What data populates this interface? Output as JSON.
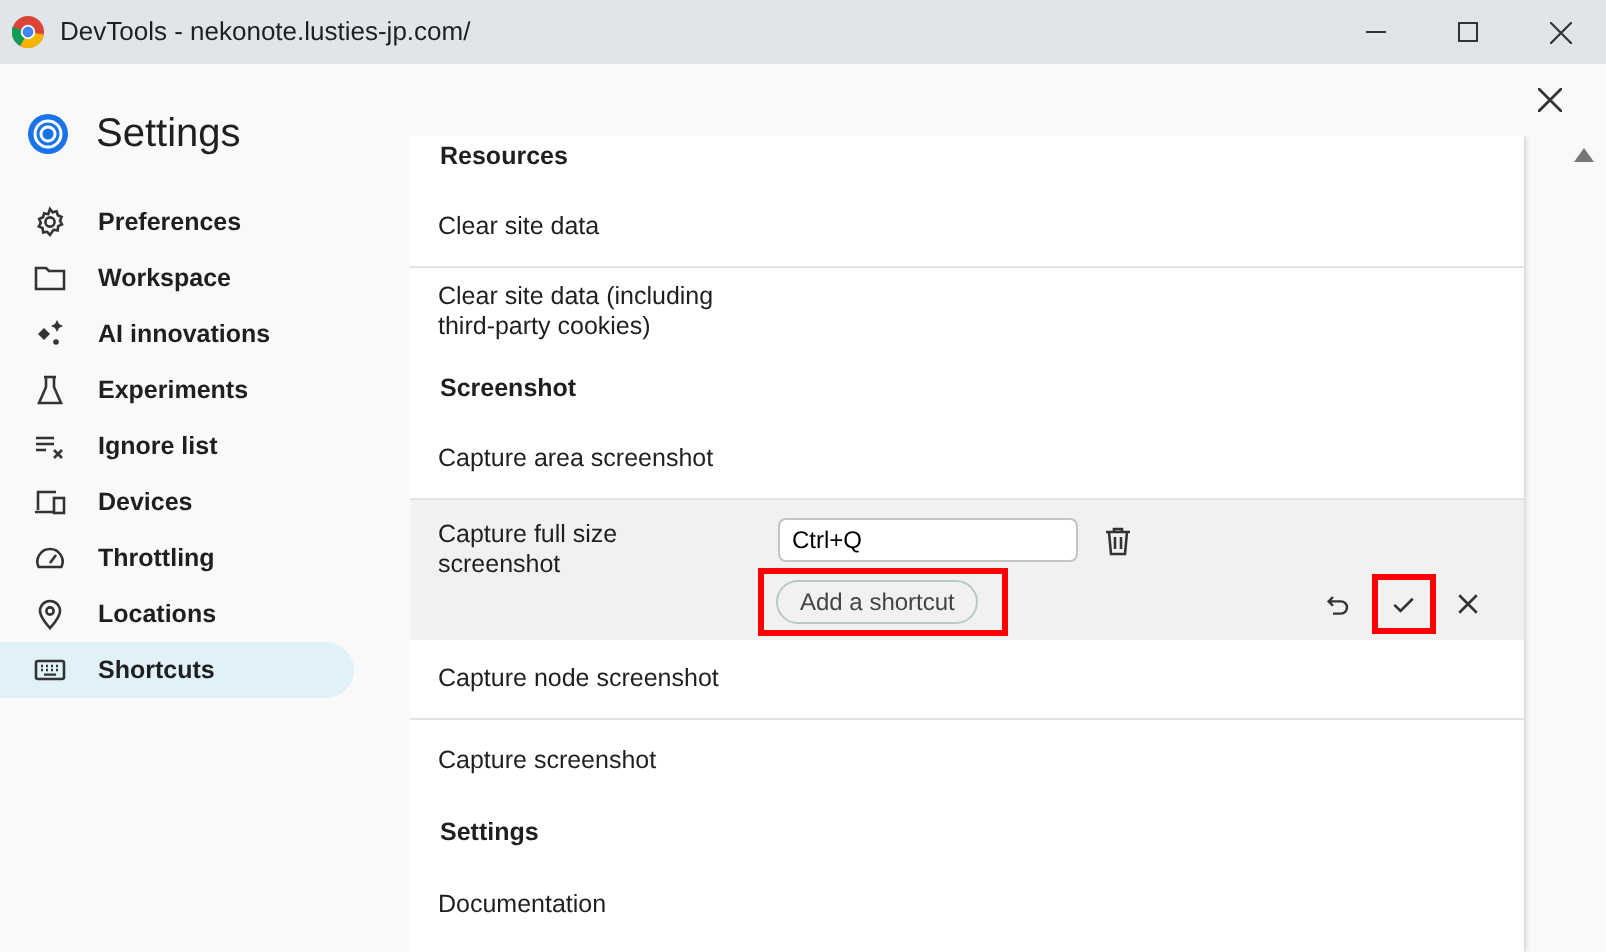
{
  "window": {
    "title": "DevTools - nekonote.lusties-jp.com/"
  },
  "settings": {
    "title": "Settings"
  },
  "sidebar": {
    "items": [
      {
        "label": "Preferences",
        "selected": false
      },
      {
        "label": "Workspace",
        "selected": false
      },
      {
        "label": "AI innovations",
        "selected": false
      },
      {
        "label": "Experiments",
        "selected": false
      },
      {
        "label": "Ignore list",
        "selected": false
      },
      {
        "label": "Devices",
        "selected": false
      },
      {
        "label": "Throttling",
        "selected": false
      },
      {
        "label": "Locations",
        "selected": false
      },
      {
        "label": "Shortcuts",
        "selected": true
      }
    ]
  },
  "content": {
    "rows": [
      {
        "kind": "heading",
        "label": "Resources"
      },
      {
        "kind": "item",
        "label": "Clear site data"
      },
      {
        "kind": "item",
        "label": "Clear site data (including third-party cookies)"
      },
      {
        "kind": "heading",
        "label": "Screenshot"
      },
      {
        "kind": "item",
        "label": "Capture area screenshot"
      },
      {
        "kind": "editing",
        "label": "Capture full size screenshot",
        "shortcut": {
          "value": "Ctrl+Q"
        },
        "add_button": {
          "label": "Add a shortcut",
          "highlighted": true
        },
        "actions": [
          {
            "kind": "undo",
            "highlighted": false
          },
          {
            "kind": "confirm",
            "highlighted": true
          },
          {
            "kind": "cancel",
            "highlighted": false
          }
        ]
      },
      {
        "kind": "item",
        "label": "Capture node screenshot"
      },
      {
        "kind": "item",
        "label": "Capture screenshot"
      },
      {
        "kind": "heading",
        "label": "Settings"
      },
      {
        "kind": "item",
        "label": "Documentation"
      }
    ]
  }
}
